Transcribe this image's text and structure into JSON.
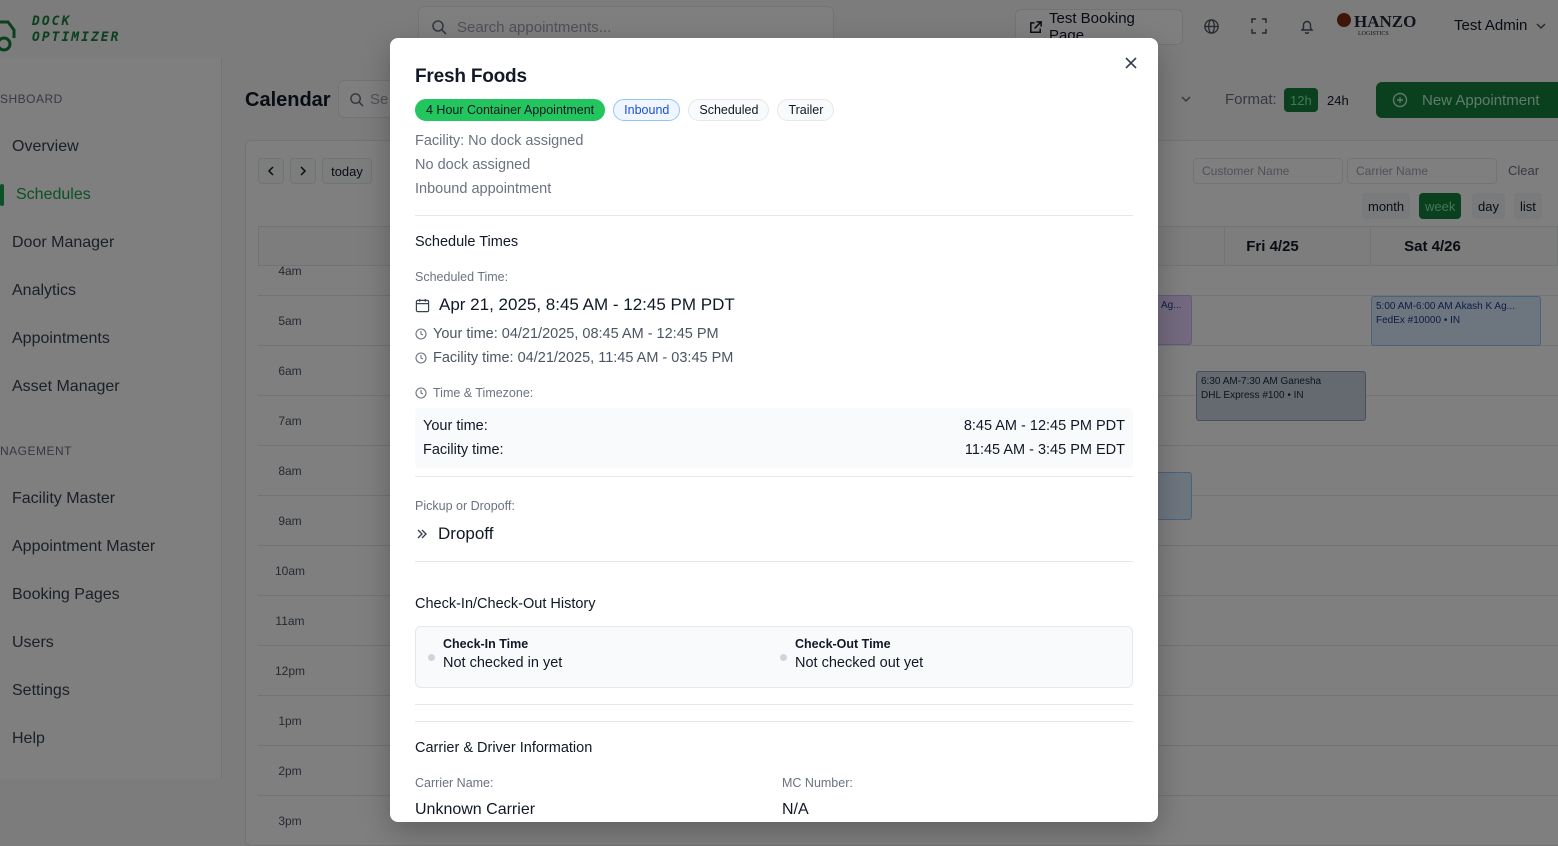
{
  "app": {
    "logo_text_1": "DOCK",
    "logo_text_2": "OPTIMIZER",
    "search_placeholder": "Search appointments...",
    "test_booking_label": "Test Booking Page",
    "brand_name": "HANZO",
    "brand_sub": "LOGISTICS",
    "user_name": "Test Admin"
  },
  "sidebar": {
    "section_dashboard": "SHBOARD",
    "section_management": "NAGEMENT",
    "items": [
      {
        "label": "Overview"
      },
      {
        "label": "Schedules"
      },
      {
        "label": "Door Manager"
      },
      {
        "label": "Analytics"
      },
      {
        "label": "Appointments"
      },
      {
        "label": "Asset Manager"
      },
      {
        "label": "Facility Master"
      },
      {
        "label": "Appointment Master"
      },
      {
        "label": "Booking Pages"
      },
      {
        "label": "Users"
      },
      {
        "label": "Settings"
      },
      {
        "label": "Help"
      }
    ]
  },
  "calendar": {
    "title": "Calendar",
    "search_placeholder": "Se",
    "format_label": "Format:",
    "format_12h": "12h",
    "format_24h": "24h",
    "new_appointment": "New Appointment",
    "today": "today",
    "customer_placeholder": "Customer Name",
    "carrier_placeholder": "Carrier Name",
    "clear": "Clear",
    "views": [
      "month",
      "week",
      "day",
      "list"
    ],
    "active_view": "week",
    "columns": [
      "Fri 4/25",
      "Sat 4/26"
    ],
    "time_labels": [
      "4am",
      "5am",
      "6am",
      "7am",
      "8am",
      "9am",
      "10am",
      "11am",
      "12pm",
      "1pm",
      "2pm",
      "3pm"
    ],
    "events": [
      {
        "line1": "Ag...",
        "line2": ""
      },
      {
        "line1": "5:00 AM-6:00 AM Akash K Ag...",
        "line2": "FedEx #10000 • IN"
      },
      {
        "line1": "6:30 AM-7:30 AM Ganesha",
        "line2": "DHL Express #100 • IN"
      }
    ]
  },
  "modal": {
    "title": "Fresh Foods",
    "badges": [
      {
        "label": "4 Hour Container Appointment"
      },
      {
        "label": "Inbound"
      },
      {
        "label": "Scheduled"
      },
      {
        "label": "Trailer"
      }
    ],
    "facility_line": "Facility: No dock assigned",
    "dock_line": "No dock assigned",
    "direction_line": "Inbound appointment",
    "schedule_section": "Schedule Times",
    "scheduled_time_label": "Scheduled Time:",
    "scheduled_time_value": "Apr 21, 2025, 8:45 AM - 12:45 PM PDT",
    "your_time_line": "Your time: 04/21/2025, 08:45 AM - 12:45 PM",
    "facility_time_line": "Facility time: 04/21/2025, 11:45 AM - 03:45 PM",
    "tz_label": "Time & Timezone:",
    "tz_your_key": "Your time:",
    "tz_your_val": "8:45 AM - 12:45 PM PDT",
    "tz_facility_key": "Facility time:",
    "tz_facility_val": "11:45 AM - 3:45 PM EDT",
    "pickup_label": "Pickup or Dropoff:",
    "pickup_value": "Dropoff",
    "checkin_section": "Check-In/Check-Out History",
    "checkin_title": "Check-In Time",
    "checkin_value": "Not checked in yet",
    "checkout_title": "Check-Out Time",
    "checkout_value": "Not checked out yet",
    "carrier_section": "Carrier & Driver Information",
    "carrier_name_label": "Carrier Name:",
    "carrier_name_value": "Unknown Carrier",
    "mc_label": "MC Number:",
    "mc_value": "N/A"
  },
  "colors": {
    "brand_green": "#15803d",
    "badge_green": "#22c55e",
    "badge_blue_text": "#1d4ed8",
    "overlay": "rgba(0,0,0,0.5)"
  },
  "icons": [
    "search-icon",
    "external-link-icon",
    "globe-icon",
    "fullscreen-icon",
    "bell-icon",
    "chevron-down-icon",
    "plus-circle-icon",
    "close-icon",
    "calendar-icon",
    "clock-icon",
    "double-chevron-right-icon"
  ]
}
